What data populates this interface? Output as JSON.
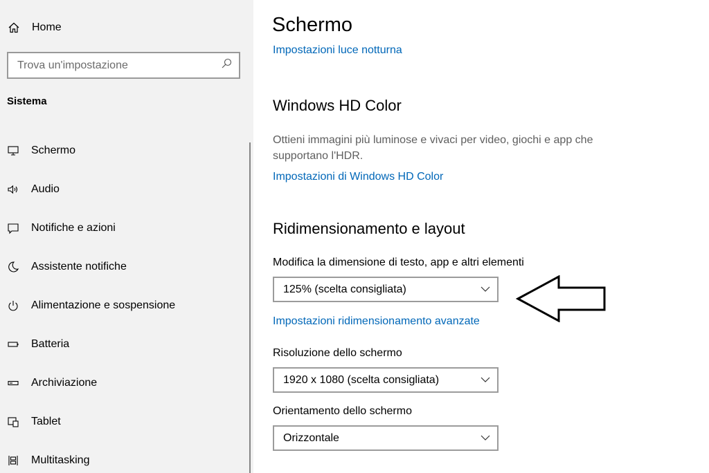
{
  "sidebar": {
    "home_label": "Home",
    "search_placeholder": "Trova un'impostazione",
    "section_title": "Sistema",
    "items": [
      {
        "label": "Schermo",
        "icon": "monitor-icon"
      },
      {
        "label": "Audio",
        "icon": "speaker-icon"
      },
      {
        "label": "Notifiche e azioni",
        "icon": "notification-icon"
      },
      {
        "label": "Assistente notifiche",
        "icon": "moon-icon"
      },
      {
        "label": "Alimentazione e sospensione",
        "icon": "power-icon"
      },
      {
        "label": "Batteria",
        "icon": "battery-icon"
      },
      {
        "label": "Archiviazione",
        "icon": "storage-icon"
      },
      {
        "label": "Tablet",
        "icon": "tablet-icon"
      },
      {
        "label": "Multitasking",
        "icon": "multitasking-icon"
      }
    ]
  },
  "main": {
    "title": "Schermo",
    "night_light_link": "Impostazioni luce notturna",
    "hd_color": {
      "heading": "Windows HD Color",
      "description": "Ottieni immagini più luminose e vivaci per video, giochi e app che supportano l'HDR.",
      "link": "Impostazioni di Windows HD Color"
    },
    "scale_layout": {
      "heading": "Ridimensionamento e layout",
      "scale_label": "Modifica la dimensione di testo, app e altri elementi",
      "scale_value": "125% (scelta consigliata)",
      "advanced_link": "Impostazioni ridimensionamento avanzate",
      "resolution_label": "Risoluzione dello schermo",
      "resolution_value": "1920 x 1080 (scelta consigliata)",
      "orientation_label": "Orientamento dello schermo",
      "orientation_value": "Orizzontale"
    }
  },
  "colors": {
    "accent": "#0067b8",
    "sidebar_bg": "#f2f2f2"
  }
}
